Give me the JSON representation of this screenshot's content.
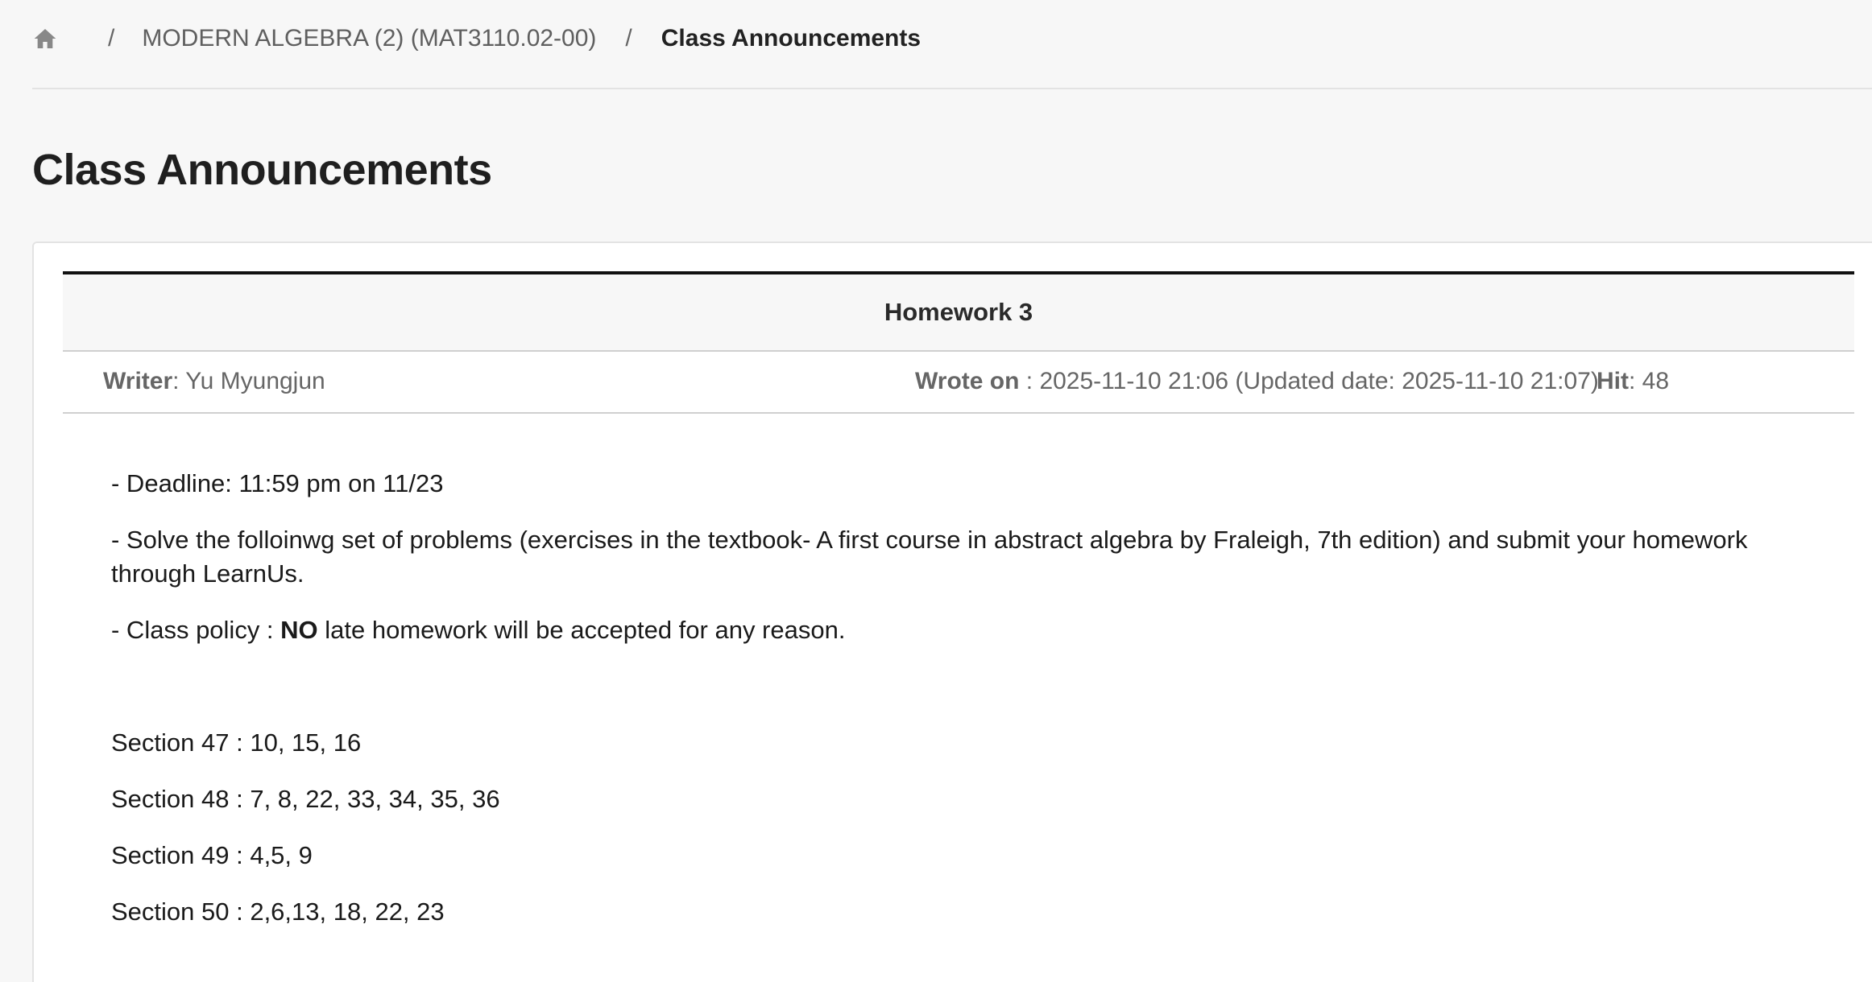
{
  "breadcrumb": {
    "home_icon": "home-icon",
    "separator": "/",
    "course": "MODERN ALGEBRA (2) (MAT3110.02-00)",
    "current": "Class Announcements"
  },
  "page": {
    "title": "Class Announcements"
  },
  "post": {
    "title": "Homework 3",
    "meta": {
      "writer_label": "Writer",
      "writer": ": Yu Myungjun",
      "wrote_on_label": "Wrote on",
      "wrote_on": " : 2025-11-10 21:06 (Updated date: 2025-11-10 21:07)",
      "hit_label": "Hit",
      "hit": ": 48"
    },
    "body": {
      "deadline": "- Deadline: 11:59 pm on 11/23",
      "instructions": "- Solve the folloinwg set of problems (exercises in the textbook- A first course in abstract algebra by Fraleigh, 7th edition) and submit your homework through LearnUs.",
      "policy_prefix": "- Class policy : ",
      "policy_bold": "NO",
      "policy_suffix": " late homework will be accepted for any reason.",
      "sections": [
        "Section 47 : 10, 15, 16",
        "Section 48 : 7, 8, 22, 33, 34, 35, 36",
        "Section 49 : 4,5, 9",
        "Section 50 : 2,6,13, 18, 22, 23"
      ]
    }
  },
  "colors": {
    "background": "#f7f7f7",
    "card": "#ffffff",
    "title_border": "#111111",
    "muted_text": "#666666"
  }
}
